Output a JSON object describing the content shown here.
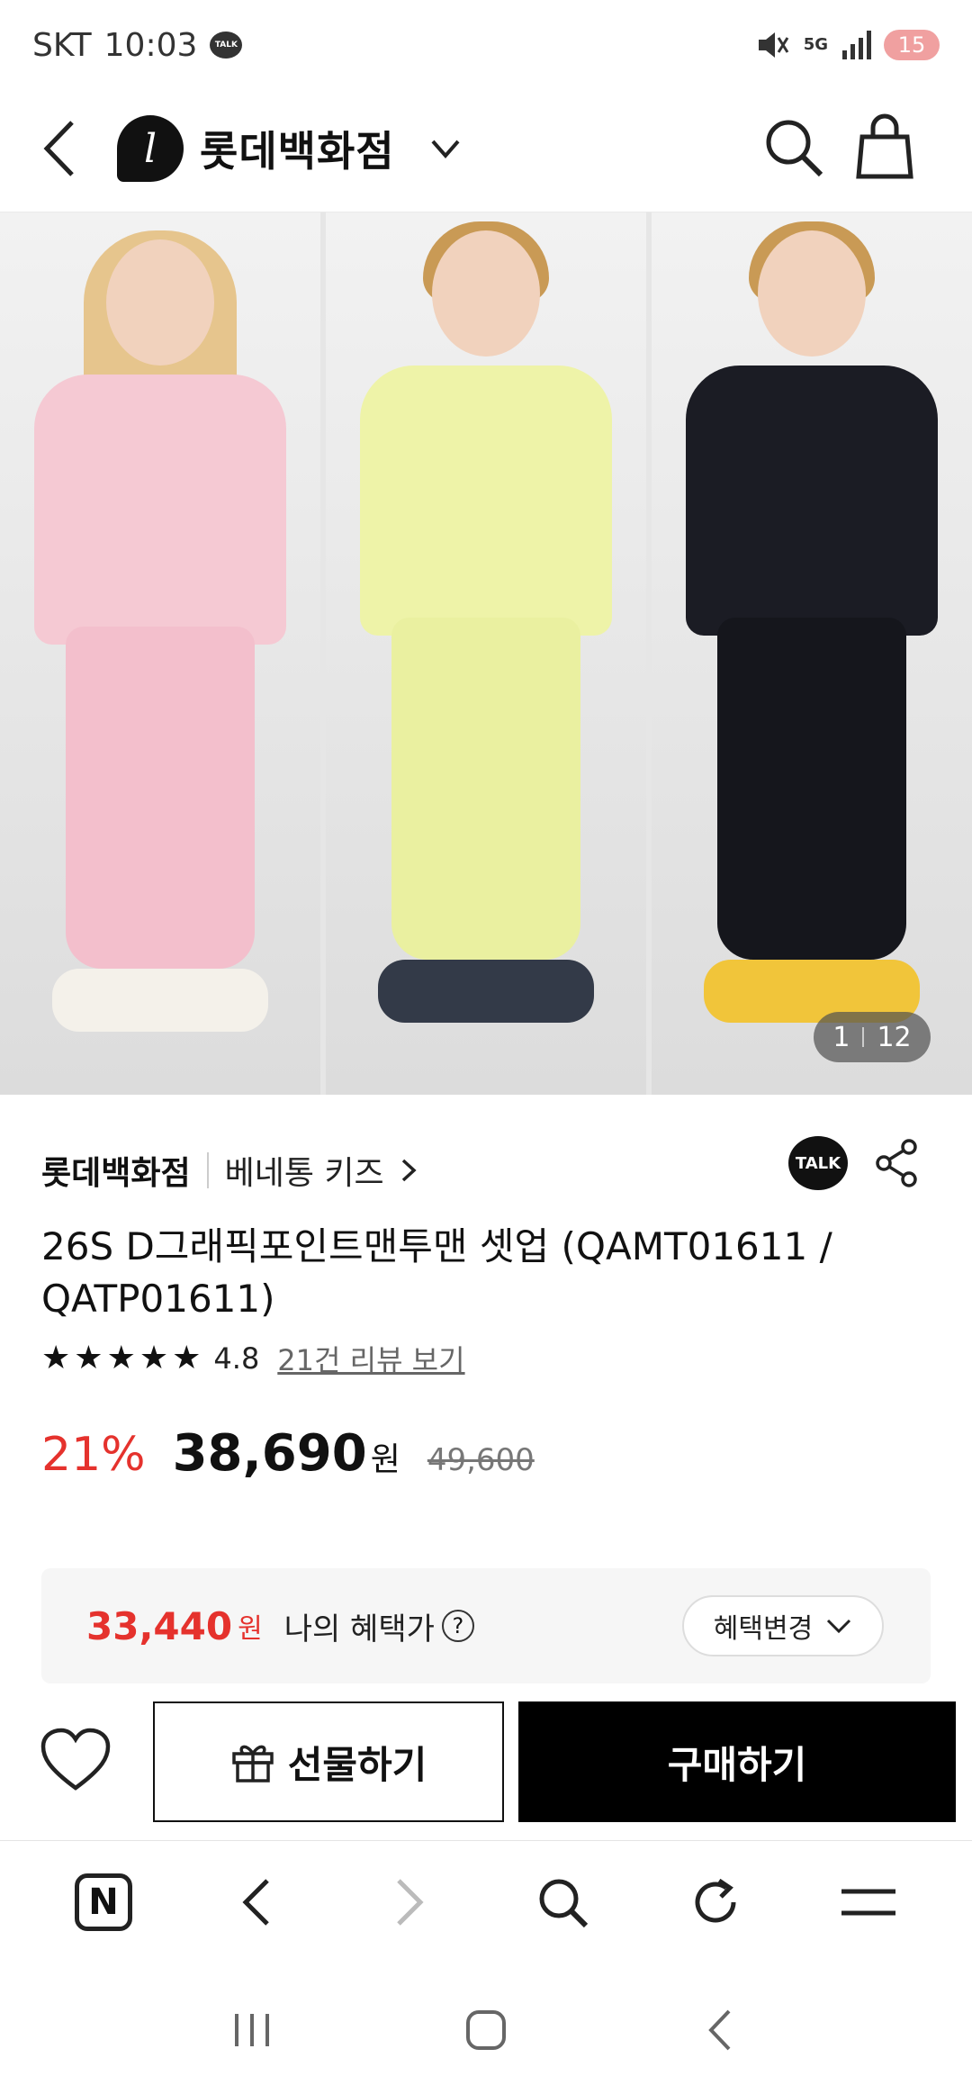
{
  "status_bar": {
    "carrier": "SKT",
    "time": "10:03",
    "talk_badge": "TALK",
    "network": "5G",
    "battery": "15"
  },
  "header": {
    "brand_name": "롯데백화점",
    "brand_logo_letter": "l"
  },
  "gallery": {
    "current": "1",
    "total": "12"
  },
  "product": {
    "seller": "롯데백화점",
    "brand": "베네통 키즈",
    "talk_label": "TALK",
    "title": "26S D그래픽포인트맨투맨 셋업 (QAMT01611 / QATP01611)",
    "rating": "4.8",
    "star_count": 5,
    "review_link": "21건 리뷰 보기",
    "discount": "21%",
    "price": "38,690",
    "currency": "원",
    "original_price": "49,600"
  },
  "benefit": {
    "price": "33,440",
    "currency": "원",
    "label": "나의 혜택가",
    "help": "?",
    "change_label": "혜택변경"
  },
  "actions": {
    "gift_label": "선물하기",
    "buy_label": "구매하기"
  },
  "browser": {
    "home_letter": "N"
  },
  "colors": {
    "accent_red": "#e5322d",
    "buy_button": "#000000"
  }
}
